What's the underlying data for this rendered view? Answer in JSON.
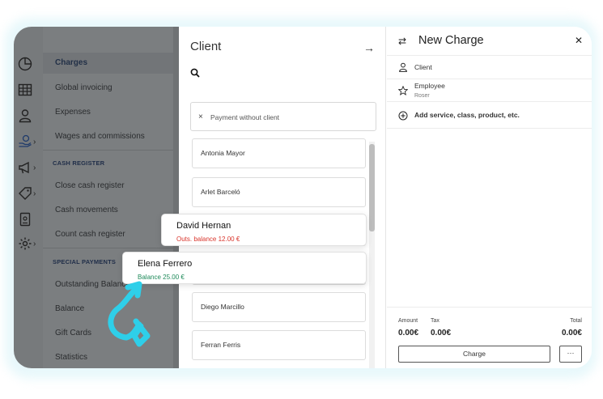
{
  "colors": {
    "accent": "#2ecfe9",
    "outstanding": "#d9342b",
    "balance": "#1e8a5a"
  },
  "sidebar": {
    "items": [
      {
        "label": "Charges"
      },
      {
        "label": "Global invoicing"
      },
      {
        "label": "Expenses"
      },
      {
        "label": "Wages and commissions"
      }
    ],
    "cash_register_heading": "CASH REGISTER",
    "cash_items": [
      {
        "label": "Close cash register"
      },
      {
        "label": "Cash movements"
      },
      {
        "label": "Count cash register"
      }
    ],
    "special_heading": "SPECIAL PAYMENTS",
    "special_items": [
      {
        "label": "Outstanding Balance"
      },
      {
        "label": "Balance"
      },
      {
        "label": "Gift Cards"
      },
      {
        "label": "Statistics"
      }
    ]
  },
  "client_panel": {
    "title": "Client",
    "payment_without_client": "Payment without client",
    "clients": [
      {
        "name": "Antonia Mayor"
      },
      {
        "name": "Arlet Barceló"
      },
      {
        "name": "Diego Marcillo"
      },
      {
        "name": "Ferran Ferris"
      }
    ],
    "highlighted": [
      {
        "name": "David Hernan",
        "balance": "Outs. balance 12.00 €"
      },
      {
        "name": "Elena Ferrero",
        "balance": "Balance 25.00 €"
      }
    ]
  },
  "charge_panel": {
    "title": "New Charge",
    "client_label": "Client",
    "employee_label": "Employee",
    "employee_value": "Roser",
    "add_label": "Add service, class, product, etc.",
    "amount_label": "Amount",
    "tax_label": "Tax",
    "total_label": "Total",
    "amount_value": "0.00€",
    "tax_value": "0.00€",
    "total_value": "0.00€",
    "charge_button": "Charge",
    "more_button": "···"
  }
}
